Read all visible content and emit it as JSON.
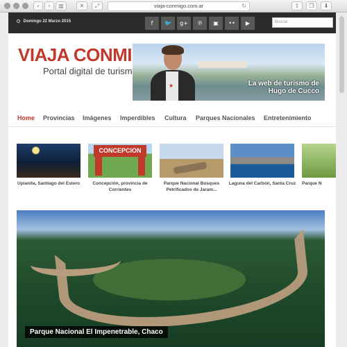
{
  "browser": {
    "url": "viaja-conmigo.com.ar"
  },
  "topbar": {
    "date": "Domingo 22 Marzo 2015",
    "social": [
      "facebook-icon",
      "twitter-icon",
      "google-plus-icon",
      "pinterest-icon",
      "instagram-icon",
      "flickr-icon",
      "youtube-icon"
    ],
    "search_placeholder": "Buscar"
  },
  "header": {
    "logo_line1": "VIAJA CONMIGO",
    "logo_line2": "Portal digital de turismo",
    "banner_line1": "La web de turismo de",
    "banner_line2": "Hugo de Cucco"
  },
  "nav": {
    "items": [
      "Home",
      "Provincias",
      "Imágenes",
      "Imperdibles",
      "Cultura",
      "Parques Nacionales",
      "Entretenimiento"
    ]
  },
  "thumbs": [
    {
      "caption": "Upianita, Santiago del Estero"
    },
    {
      "caption": "Concepción, provincia de Corrientes",
      "sign": "CONCEPCION"
    },
    {
      "caption": "Parque Nacional Bosques Petrificados de Jaram..."
    },
    {
      "caption": "Laguna del Carbón, Santa Cruz"
    },
    {
      "caption": "Parque N"
    }
  ],
  "feature": {
    "caption": "Parque Nacional El Impenetrable, Chaco"
  },
  "colors": {
    "accent": "#c0392b",
    "topbar": "#2c2c2c"
  }
}
